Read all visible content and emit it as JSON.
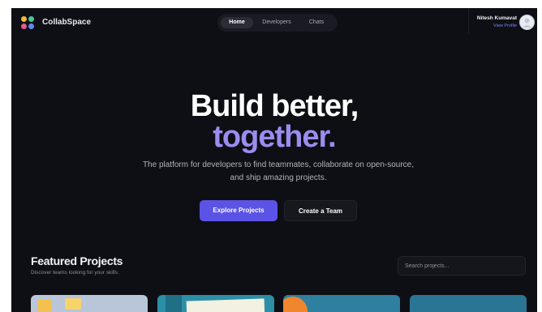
{
  "brand": {
    "name": "CollabSpace",
    "logo_colors": [
      "#f4b73a",
      "#4bc59a",
      "#e45a8d",
      "#5b8def"
    ]
  },
  "nav": {
    "items": [
      {
        "label": "Home",
        "active": true
      },
      {
        "label": "Developers",
        "active": false
      },
      {
        "label": "Chats",
        "active": false
      }
    ]
  },
  "profile": {
    "name": "Nitesh Kumavat",
    "link": "View Profile"
  },
  "hero": {
    "line1": "Build better,",
    "line2": "together.",
    "subtitle_line1": "The platform for developers to find teammates, collaborate on open-source,",
    "subtitle_line2": "and ship amazing projects."
  },
  "actions": {
    "primary": "Explore Projects",
    "secondary": "Create a Team"
  },
  "featured": {
    "title": "Featured Projects",
    "subtitle": "Discover teams looking for your skills.",
    "search_placeholder": "Search projects..."
  },
  "colors": {
    "accent": "#5b53e6",
    "accent_text": "#9b8cf0",
    "background": "#0e0f14",
    "link": "#7f82ff"
  }
}
